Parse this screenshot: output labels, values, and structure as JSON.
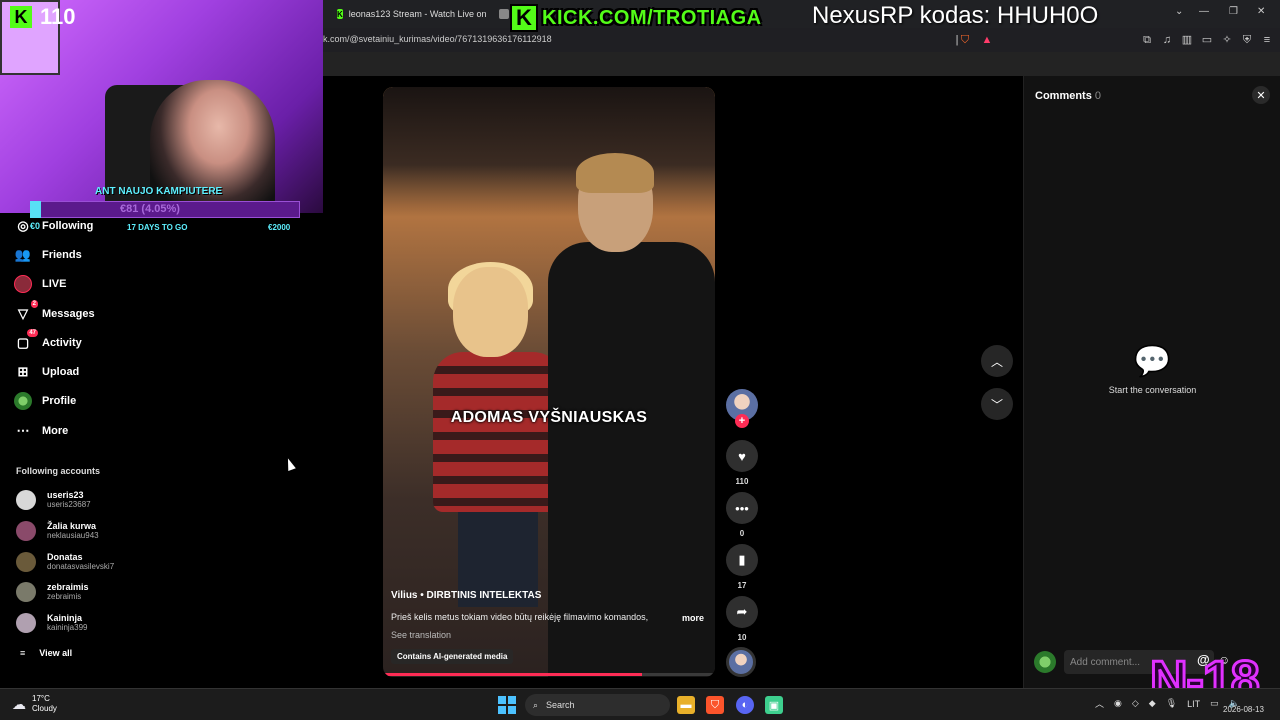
{
  "overlay": {
    "kick_follower_count": "110",
    "kick_link": "KICK.COM/TROTIAGA",
    "nexus_promo": "NexusRP kodas: HHUH0O",
    "age_rating": "N-18",
    "goal_title": "ANT NAUJO KAMPIUTERE",
    "goal_amount": "€81 (4.05%)",
    "goal_days": "17 DAYS TO GO",
    "goal_target": "€2000",
    "goal_start": "€0",
    "goal_progress": 0.0405
  },
  "browser": {
    "tabs": [
      {
        "label": "leonas123 Stream - Watch Live on Ki"
      },
      {
        "label": ""
      }
    ],
    "url": "k.com/@svetainiu_kurimas/video/7671319636176112918"
  },
  "sidebar": {
    "items": [
      {
        "label": "Following",
        "icon": "following-icon"
      },
      {
        "label": "Friends",
        "icon": "friends-icon"
      },
      {
        "label": "LIVE",
        "icon": "live-icon"
      },
      {
        "label": "Messages",
        "icon": "messages-icon",
        "badge": "2"
      },
      {
        "label": "Activity",
        "icon": "activity-icon",
        "badge": "47"
      },
      {
        "label": "Upload",
        "icon": "upload-icon"
      },
      {
        "label": "Profile",
        "icon": "profile-icon"
      },
      {
        "label": "More",
        "icon": "more-icon"
      }
    ],
    "following_header": "Following accounts",
    "accounts": [
      {
        "name": "useris23",
        "handle": "useris23687",
        "color": "#d8d8d8"
      },
      {
        "name": "Žalia kurwa",
        "handle": "neklausiau943",
        "color": "#8a4a6a"
      },
      {
        "name": "Donatas",
        "handle": "donatasvasilevski7",
        "color": "#6a5a3a"
      },
      {
        "name": "zebraimis",
        "handle": "zebraimis",
        "color": "#7a7a6a"
      },
      {
        "name": "Kaininja",
        "handle": "kaininja399",
        "color": "#b0a0b0"
      }
    ],
    "view_all": "View all"
  },
  "video": {
    "caption": "ADOMAS VYŠNIAUSKAS",
    "author_line": "Vilius • DIRBTINIS INTELEKTAS",
    "description": "Prieš kelis metus tokiam video būtų reikėję filmavimo komandos,",
    "more_label": "more",
    "see_translation": "See translation",
    "ai_tag": "Contains AI-generated media",
    "progress": 0.78
  },
  "actions": {
    "likes": "110",
    "comments": "0",
    "saves": "17",
    "shares": "10"
  },
  "comments_panel": {
    "title": "Comments",
    "count": "0",
    "empty_text": "Start the conversation",
    "input_placeholder": "Add comment..."
  },
  "taskbar": {
    "temp": "17°C",
    "condition": "Cloudy",
    "search_label": "Search",
    "lang": "LIT",
    "date": "2026-08-13"
  },
  "colors": {
    "accent": "#fe2c55",
    "kick_green": "#53fc18",
    "overlay_purple": "#e030ff"
  }
}
